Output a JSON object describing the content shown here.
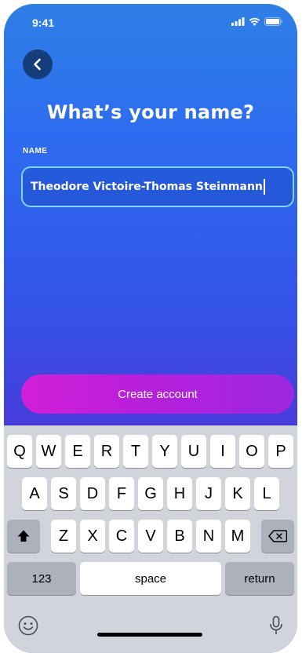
{
  "status_bar": {
    "time": "9:41"
  },
  "header": {
    "title": "What’s your name?"
  },
  "form": {
    "name_label": "NAME",
    "name_value": "Theodore Victoire-Thomas Steinmann"
  },
  "actions": {
    "create_account_label": "Create account"
  },
  "keyboard": {
    "row1": [
      "Q",
      "W",
      "E",
      "R",
      "T",
      "Y",
      "U",
      "I",
      "O",
      "P"
    ],
    "row2": [
      "A",
      "S",
      "D",
      "F",
      "G",
      "H",
      "J",
      "K",
      "L"
    ],
    "row3": [
      "Z",
      "X",
      "C",
      "V",
      "B",
      "N",
      "M"
    ],
    "numbers_label": "123",
    "space_label": "space",
    "return_label": "return",
    "icons": [
      "shift-icon",
      "backspace-icon",
      "emoji-icon",
      "microphone-icon"
    ]
  }
}
